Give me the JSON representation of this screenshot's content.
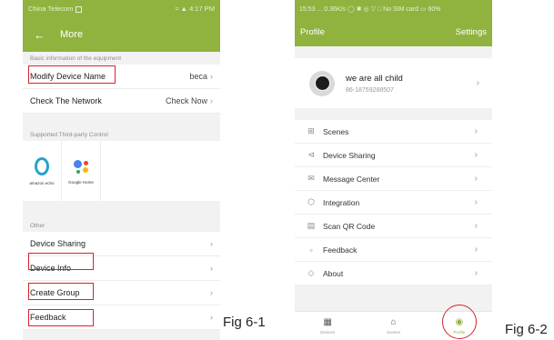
{
  "left_phone": {
    "status": {
      "carrier": "China Telecom",
      "indicators": "4:17 PM"
    },
    "header": {
      "title": "More"
    },
    "basic_section": "Basic information of the equipment",
    "modify_name": {
      "label": "Modify Device Name",
      "value": "beca"
    },
    "check_network": {
      "label": "Check The Network",
      "value": "Check Now"
    },
    "third_party_section": "Supported Third-party Control",
    "alexa_label": "amazon echo",
    "google_label": "Google Home",
    "other_section": "Other",
    "other_items": [
      "Device Sharing",
      "Device Info",
      "Create Group",
      "Feedback"
    ]
  },
  "right_phone": {
    "status": "15:53 ... 0.36K/s ◯ ✱ ◎ ▽ □ No SIM card ▭ 60%",
    "header": {
      "title": "Profile",
      "settings": "Settings"
    },
    "profile": {
      "name": "we are all child",
      "phone": "86-18759288507"
    },
    "menu": [
      {
        "icon": "scenes-icon",
        "label": "Scenes"
      },
      {
        "icon": "share-icon",
        "label": "Device Sharing"
      },
      {
        "icon": "message-icon",
        "label": "Message Center"
      },
      {
        "icon": "integration-icon",
        "label": "Integration"
      },
      {
        "icon": "qr-code-icon",
        "label": "Scan QR Code"
      },
      {
        "icon": "feedback-icon",
        "label": "Feedback"
      },
      {
        "icon": "about-icon",
        "label": "About"
      }
    ],
    "tabs": [
      "Devices",
      "Scenes",
      "Profile"
    ],
    "active_tab": "Profile"
  },
  "captions": {
    "fig1": "Fig 6-1",
    "fig2": "Fig 6-2"
  },
  "colors": {
    "accent": "#8fb33e",
    "highlight": "#d8232a"
  }
}
